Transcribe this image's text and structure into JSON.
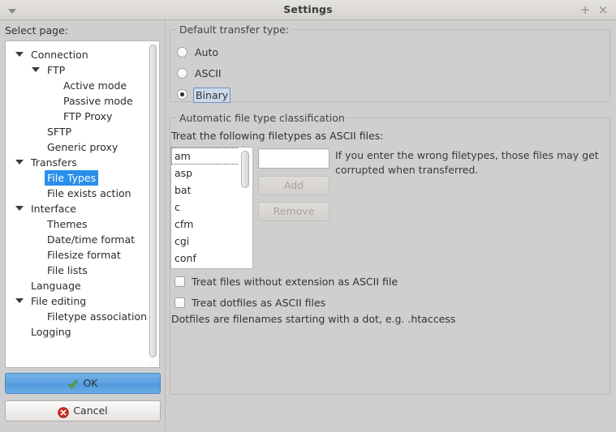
{
  "window": {
    "title": "Settings",
    "menu_icon": "menu-triangle-icon",
    "maximize_label": "+",
    "close_label": "×"
  },
  "sidebar": {
    "label": "Select page:",
    "items": [
      {
        "label": "Connection",
        "level": 0,
        "expandable": true,
        "selected": false
      },
      {
        "label": "FTP",
        "level": 1,
        "expandable": true,
        "selected": false
      },
      {
        "label": "Active mode",
        "level": 2,
        "expandable": false,
        "selected": false
      },
      {
        "label": "Passive mode",
        "level": 2,
        "expandable": false,
        "selected": false
      },
      {
        "label": "FTP Proxy",
        "level": 2,
        "expandable": false,
        "selected": false
      },
      {
        "label": "SFTP",
        "level": 1,
        "expandable": false,
        "selected": false
      },
      {
        "label": "Generic proxy",
        "level": 1,
        "expandable": false,
        "selected": false
      },
      {
        "label": "Transfers",
        "level": 0,
        "expandable": true,
        "selected": false
      },
      {
        "label": "File Types",
        "level": 1,
        "expandable": false,
        "selected": true
      },
      {
        "label": "File exists action",
        "level": 1,
        "expandable": false,
        "selected": false
      },
      {
        "label": "Interface",
        "level": 0,
        "expandable": true,
        "selected": false
      },
      {
        "label": "Themes",
        "level": 1,
        "expandable": false,
        "selected": false
      },
      {
        "label": "Date/time format",
        "level": 1,
        "expandable": false,
        "selected": false
      },
      {
        "label": "Filesize format",
        "level": 1,
        "expandable": false,
        "selected": false
      },
      {
        "label": "File lists",
        "level": 1,
        "expandable": false,
        "selected": false
      },
      {
        "label": "Language",
        "level": 0,
        "expandable": false,
        "selected": false
      },
      {
        "label": "File editing",
        "level": 0,
        "expandable": true,
        "selected": false
      },
      {
        "label": "Filetype associations",
        "level": 1,
        "expandable": false,
        "selected": false
      },
      {
        "label": "Logging",
        "level": 0,
        "expandable": false,
        "selected": false
      }
    ],
    "selection_color": "#2a8fea"
  },
  "dialog_buttons": {
    "ok_label": "OK",
    "ok_icon": "green-check-icon",
    "cancel_label": "Cancel",
    "cancel_icon": "red-x-circle-icon"
  },
  "transfer_type": {
    "group_title": "Default transfer type:",
    "options": [
      {
        "label": "Auto",
        "checked": false,
        "focused": false
      },
      {
        "label": "ASCII",
        "checked": false,
        "focused": false
      },
      {
        "label": "Binary",
        "checked": true,
        "focused": true
      }
    ]
  },
  "classification": {
    "group_title": "Automatic file type classification",
    "list_label": "Treat the following filetypes as ASCII files:",
    "filetypes": [
      "am",
      "asp",
      "bat",
      "c",
      "cfm",
      "cgi",
      "conf"
    ],
    "focused_filetype": "am",
    "input_value": "",
    "input_placeholder": "",
    "add_label": "Add",
    "add_enabled": false,
    "remove_label": "Remove",
    "remove_enabled": false,
    "help_text": "If you enter the wrong filetypes, those files may get corrupted when transferred.",
    "checkboxes": [
      {
        "label": "Treat files without extension as ASCII file",
        "checked": false
      },
      {
        "label": "Treat dotfiles as ASCII files",
        "checked": false
      }
    ],
    "note": "Dotfiles are filenames starting with a dot, e.g. .htaccess"
  }
}
